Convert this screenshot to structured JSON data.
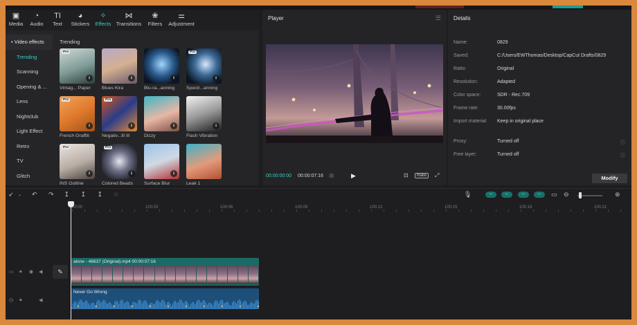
{
  "toolbar": {
    "tabs": [
      {
        "label": "Media",
        "icon": "media-icon",
        "glyph": "▣"
      },
      {
        "label": "Audio",
        "icon": "audio-icon",
        "glyph": "◔"
      },
      {
        "label": "Text",
        "icon": "text-icon",
        "glyph": "TI"
      },
      {
        "label": "Stickers",
        "icon": "stickers-icon",
        "glyph": "◕"
      },
      {
        "label": "Effects",
        "icon": "effects-icon",
        "glyph": "✧"
      },
      {
        "label": "Transitions",
        "icon": "transitions-icon",
        "glyph": "⋈"
      },
      {
        "label": "Filters",
        "icon": "filters-icon",
        "glyph": "❀"
      },
      {
        "label": "Adjustment",
        "icon": "adjustment-icon",
        "glyph": "⚌"
      }
    ],
    "active": "Effects"
  },
  "effects": {
    "category_header": "• Video effects",
    "categories": [
      "Trending",
      "Scanning",
      "Opening & ...",
      "Lens",
      "Nightclub",
      "Light Effect",
      "Retro",
      "TV",
      "Glitch"
    ],
    "active_category": "Trending",
    "section_title": "Trending",
    "items": [
      {
        "label": "Vintag... Paper",
        "pro": "Pro",
        "download": true
      },
      {
        "label": "Blues Kira",
        "pro": "",
        "download": true
      },
      {
        "label": "Blu-ra...anning",
        "pro": "",
        "download": true
      },
      {
        "label": "Spectr...anning",
        "pro": "Pro",
        "download": true
      },
      {
        "label": "French Graffiti",
        "pro": "Pro",
        "download": true
      },
      {
        "label": "Negativ...lti III",
        "pro": "Pro",
        "download": true
      },
      {
        "label": "Dizzy",
        "pro": "",
        "download": true
      },
      {
        "label": "Flash Vibration",
        "pro": "",
        "download": true
      },
      {
        "label": "INS Outline",
        "pro": "Pro",
        "download": true
      },
      {
        "label": "Colored Beads",
        "pro": "Pro",
        "download": true
      },
      {
        "label": "Surface Blur",
        "pro": "",
        "download": true
      },
      {
        "label": "Leak 1",
        "pro": "",
        "download": false
      }
    ]
  },
  "player": {
    "title": "Player",
    "current_time": "00:00:00:00",
    "total_time": "00:00:07:16",
    "ratio_label": "Ratio"
  },
  "details": {
    "title": "Details",
    "rows": [
      {
        "key": "Name:",
        "value": "0829",
        "info": false
      },
      {
        "key": "Saved:",
        "value": "C:/Users/EWThomas/Desktop/CapCut Drafts/0829",
        "info": false
      },
      {
        "key": "Ratio:",
        "value": "Original",
        "info": false
      },
      {
        "key": "Resolution:",
        "value": "Adapted",
        "info": false
      },
      {
        "key": "Color space:",
        "value": "SDR - Rec.709",
        "info": false
      },
      {
        "key": "Frame rate:",
        "value": "30.00fps",
        "info": false
      },
      {
        "key": "Import material:",
        "value": "Keep in original place",
        "info": false
      },
      {
        "key": "Proxy:",
        "value": "Turned off",
        "info": true
      },
      {
        "key": "Free layer:",
        "value": "Turned off",
        "info": true
      }
    ],
    "modify_label": "Modify"
  },
  "timeline": {
    "ruler": [
      "00:00",
      "100:03",
      "100:06",
      "100:09",
      "100:12",
      "100:15",
      "100:18",
      "100:21"
    ],
    "video_clip": "alone - 46637 (Original).mp4  00:00:07:16",
    "audio_clip": "Never Go Wrong"
  }
}
